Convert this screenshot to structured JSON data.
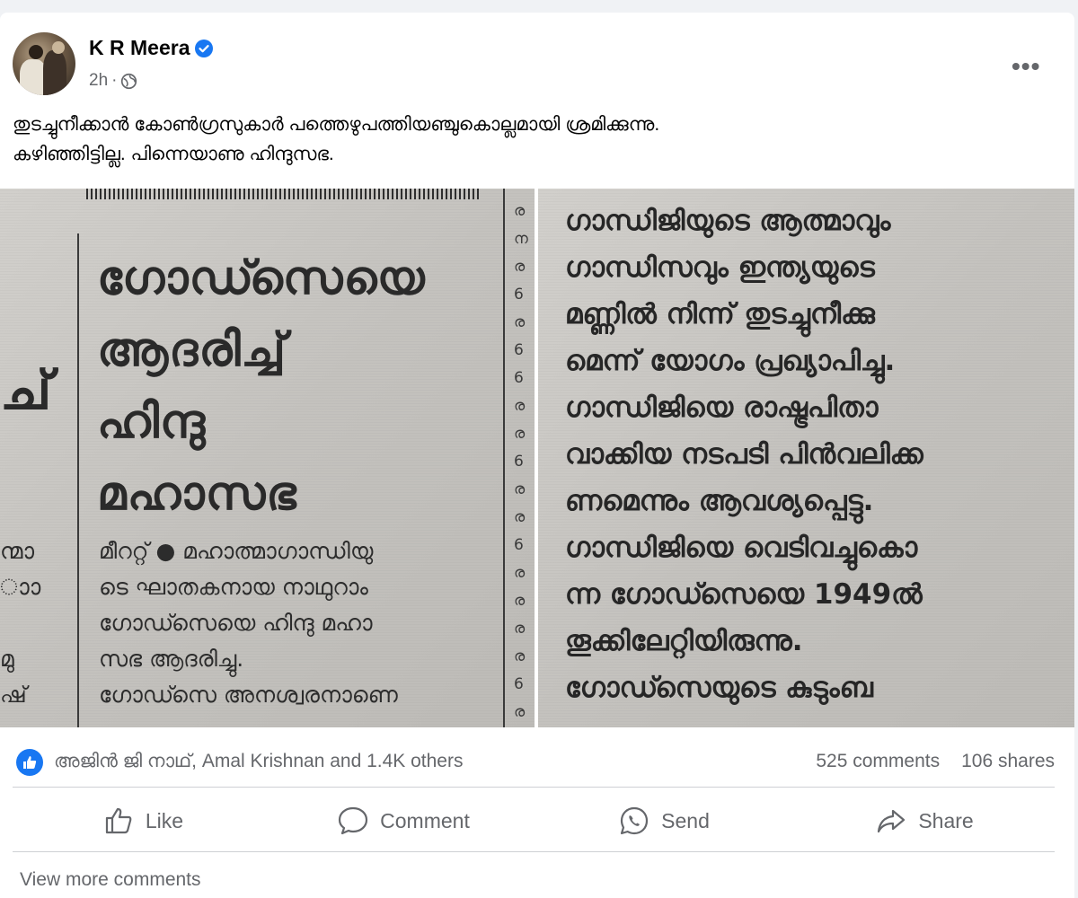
{
  "post": {
    "author": "K R Meera",
    "verified": true,
    "time": "2h",
    "time_separator": "·",
    "privacy_icon": "globe-icon",
    "more_label": "•••",
    "text_lines": [
      "തുടച്ചുനീക്കാൻ കോൺഗ്രസുകാർ പത്തെഴുപത്തിയഞ്ചുകൊല്ലമായി  ശ്രമിക്കുന്നു.",
      "കഴിഞ്ഞിട്ടില്ല.  പിന്നെയാണു ഹിന്ദുസഭ."
    ]
  },
  "media": {
    "left_photo": {
      "headline_lines": [
        "ഗോഡ്സെയെ",
        "ആദരിച്ച്",
        "ഹിന്ദു",
        "മഹാസഭ"
      ],
      "body_lines": [
        "മീററ്റ് ● മഹാത്മാഗാന്ധിയു",
        "ടെ ഘാതകനായ നാഥുറാം",
        "ഗോഡ്സെയെ ഹിന്ദു മഹാ",
        "സഭ ആദരിച്ചു.",
        "ഗോഡ്സെ അനശ്വരനാണെ"
      ],
      "edge_glyph": "ച്",
      "edge_lines": [
        "ന്മാ",
        "ാാ",
        "",
        "മു",
        "ഷ്"
      ],
      "strip_chars": [
        "ര",
        "ന",
        "ര",
        "6",
        "ര",
        "6",
        "6",
        "ര",
        "ര",
        "6",
        "ര",
        "ര",
        "6",
        "ര",
        "ര",
        "ര",
        "ര",
        "6",
        "ര"
      ]
    },
    "right_photo": {
      "body_lines": [
        "ഗാന്ധിജിയുടെ ആത്മാവും",
        "ഗാന്ധിസവും ഇന്ത്യയുടെ",
        "മണ്ണിൽ നിന്ന് തുടച്ചുനീക്കു",
        "മെന്ന് യോഗം പ്രഖ്യാപിച്ചു.",
        "ഗാന്ധിജിയെ രാഷ്ട്രപിതാ",
        "വാക്കിയ നടപടി പിൻവലിക്ക",
        "ണമെന്നും ആവശ്യപ്പെട്ടു.",
        "ഗാന്ധിജിയെ വെടിവച്ചുകൊ",
        "ന്ന ഗോഡ്സെയെ 1949ൽ",
        "തൂക്കിലേറ്റിയിരുന്നു.",
        "   ഗോഡ്സെയുടെ കുടുംബ"
      ]
    }
  },
  "stats": {
    "reaction_icon": "like-reaction-icon",
    "reactors": "അജിൻ ജി നാഥ്, Amal Krishnan and 1.4K others",
    "comments": "525 comments",
    "shares": "106 shares"
  },
  "actions": {
    "like": "Like",
    "comment": "Comment",
    "send": "Send",
    "share": "Share"
  },
  "view_more": "View more comments",
  "colors": {
    "brand_blue": "#1877f2",
    "secondary_text": "#65676b",
    "divider": "#ced0d4"
  }
}
